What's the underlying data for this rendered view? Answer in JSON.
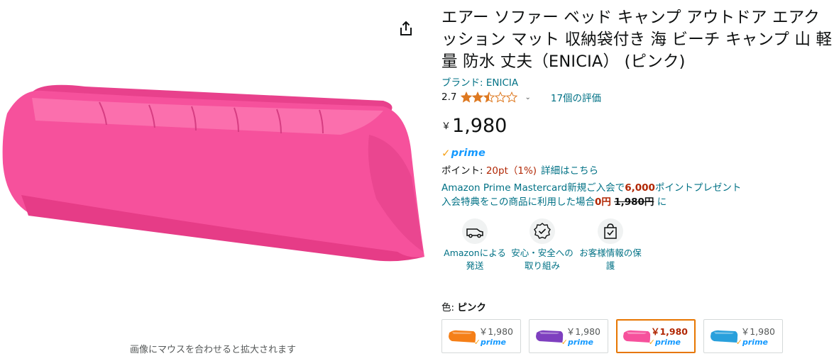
{
  "image_panel": {
    "zoom_hint": "画像にマウスを合わせると拡大されます",
    "share_icon": "share-icon",
    "product_color": "#f6519c"
  },
  "product": {
    "title": "エアー ソファー ベッド キャンプ アウトドア エアクッション マット 収納袋付き 海 ビーチ キャンプ 山 軽量 防水 丈夫（ENICIA） (ピンク)",
    "brand": "ブランド: ENICIA",
    "rating_value": "2.7",
    "rating_stars": 2.5,
    "review_count": "17個の評価",
    "price_currency": "￥",
    "price": "1,980",
    "prime_label": "prime",
    "points_label": "ポイント: ",
    "points_value": "20pt（1%)",
    "points_link": "詳細はこちら",
    "promo": {
      "line1_pre": "Amazon Prime Mastercard新規ご入会で",
      "line1_bold": "6,000",
      "line1_post": "ポイントプレゼント",
      "line2_pre": "入会特典をこの商品に利用した場合",
      "line2_bold": "0円",
      "line2_strike": "1,980円",
      "line2_post": " に"
    }
  },
  "trust": [
    {
      "label": "Amazonによる発送",
      "icon": "delivery-van-icon"
    },
    {
      "label": "安心・安全への取り組み",
      "icon": "badge-check-icon"
    },
    {
      "label": "お客様情報の保護",
      "icon": "secure-bag-icon"
    }
  ],
  "variants": {
    "label_key": "色: ",
    "label_value": "ピンク",
    "options": [
      {
        "color": "#f57f17",
        "price": "￥1,980",
        "prime": "prime",
        "selected": false
      },
      {
        "color": "#7e3fbf",
        "price": "￥1,980",
        "prime": "prime",
        "selected": false
      },
      {
        "color": "#f6519c",
        "price": "￥1,980",
        "prime": "prime",
        "selected": true
      },
      {
        "color": "#29a0dc",
        "price": "￥1,980",
        "prime": "prime",
        "selected": false
      }
    ]
  },
  "colors": {
    "link": "#007185",
    "price_red": "#b12704",
    "prime_blue": "#1399ff",
    "prime_check": "#f7a31c"
  }
}
